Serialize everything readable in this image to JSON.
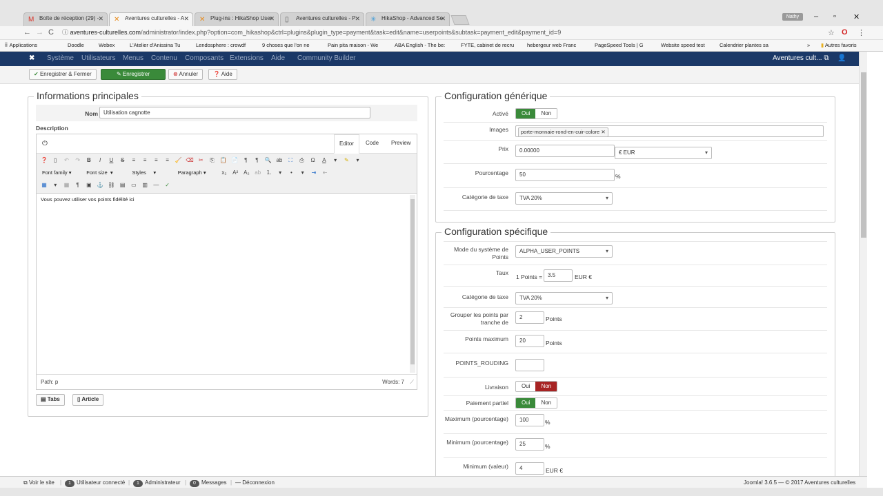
{
  "browser": {
    "tabs": [
      {
        "icon": "M",
        "icon_color": "#d93025",
        "title": "Boîte de réception (29) -"
      },
      {
        "icon": "✕",
        "icon_color": "#e88a1a",
        "title": "Aventures culturelles - A"
      },
      {
        "icon": "✕",
        "icon_color": "#e88a1a",
        "title": "Plug-ins : HikaShop User"
      },
      {
        "icon": "▯",
        "icon_color": "#555555",
        "title": "Aventures culturelles - P"
      },
      {
        "icon": "✳",
        "icon_color": "#3b9ad9",
        "title": "HikaShop - Advanced Se"
      }
    ],
    "profile": "Nathy",
    "url_host": "aventures-culturelles.com",
    "url_path": "/administrator/index.php?option=com_hikashop&ctrl=plugins&plugin_type=payment&task=edit&name=userpoints&subtask=payment_edit&payment_id=9",
    "bookmarks": [
      "Applications",
      "Doodle",
      "Webex",
      "L'Atelier d'Anissina Tu",
      "Lendosphere : crowdf",
      "9 choses que l'on ne",
      "Pain pita maison - We",
      "ABA English - The be:",
      "FYTE, cabinet de recru",
      "hebergeur web Franc",
      "PageSpeed Tools | G",
      "Website speed test",
      "Calendrier plantes sa"
    ],
    "bookmarks_more": "»",
    "bookmarks_other": "Autres favoris"
  },
  "joomla": {
    "menu": [
      "Système",
      "Utilisateurs",
      "Menus",
      "Contenu",
      "Composants",
      "Extensions",
      "Aide",
      "Community Builder"
    ],
    "site_name": "Aventures cult...",
    "toolbar": {
      "save_close": "Enregistrer & Fermer",
      "save": "Enregistrer",
      "cancel": "Annuler",
      "help": "Aide"
    }
  },
  "main_info": {
    "legend": "Informations principales",
    "name_label": "Nom",
    "name_value": "Utilisation cagnotte",
    "description_label": "Description",
    "editor": {
      "tabs": [
        "Editor",
        "Code",
        "Preview"
      ],
      "font_family": "Font family",
      "font_size": "Font size",
      "styles": "Styles",
      "paragraph": "Paragraph",
      "content": "Vous pouvez utiliser vos points fidélité ici",
      "path": "Path: p",
      "words": "Words: 7"
    },
    "tabs_button": "Tabs",
    "article_button": "Article"
  },
  "generic_config": {
    "legend": "Configuration générique",
    "active_label": "Activé",
    "yes": "Oui",
    "no": "Non",
    "images_label": "Images",
    "image_tag": "porte-monnaie-rond-en-cuir-colore",
    "price_label": "Prix",
    "price_value": "0.00000",
    "currency": "€ EUR",
    "percent_label": "Pourcentage",
    "percent_value": "50",
    "percent_suffix": "%",
    "tax_label": "Catégorie de taxe",
    "tax_value": "TVA 20%"
  },
  "specific_config": {
    "legend": "Configuration spécifique",
    "mode_label_1": "Mode du système de",
    "mode_label_2": "Points",
    "mode_value": "ALPHA_USER_POINTS",
    "rate_label": "Taux",
    "rate_prefix": "1 Points =",
    "rate_value": "3.5",
    "rate_suffix": "EUR €",
    "tax_label": "Catégorie de taxe",
    "tax_value": "TVA 20%",
    "group_label_1": "Grouper les points par",
    "group_label_2": "tranche de",
    "group_value": "2",
    "points_unit": "Points",
    "max_points_label": "Points maximum",
    "max_points_value": "20",
    "rounding_label": "POINTS_ROUDING",
    "rounding_value": "",
    "shipping_label": "Livraison",
    "partial_label": "Paiement partiel",
    "max_percent_label": "Maximum (pourcentage)",
    "max_percent_value": "100",
    "min_percent_label": "Minimum (pourcentage)",
    "min_percent_value": "25",
    "min_value_label": "Minimum (valeur)",
    "min_value_value": "4",
    "min_value_suffix": "EUR €",
    "yes": "Oui",
    "no": "Non",
    "percent": "%"
  },
  "statusbar": {
    "view_site": "Voir le site",
    "users_count": "1",
    "users_label": "Utilisateur connecté",
    "admin_count": "1",
    "admin_label": "Administrateur",
    "messages_count": "0",
    "messages_label": "Messages",
    "logout": "Déconnexion",
    "version": "Joomla! 3.6.5 — © 2017 Aventures culturelles"
  }
}
